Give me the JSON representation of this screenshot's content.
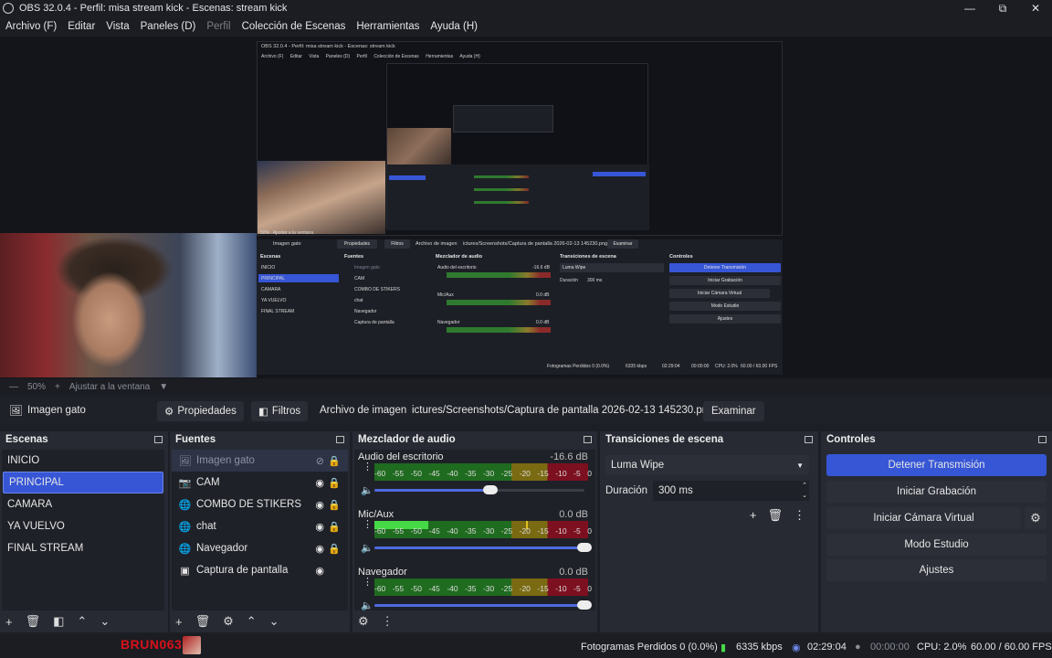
{
  "window": {
    "title": "OBS 32.0.4 - Perfil: misa stream kick - Escenas: stream kick",
    "min_icon": "minimize-icon",
    "max_icon": "maximize-icon",
    "close_icon": "close-icon"
  },
  "menu": {
    "items": [
      "Archivo (F)",
      "Editar",
      "Vista",
      "Paneles (D)",
      "Perfil",
      "Colección de Escenas",
      "Herramientas",
      "Ayuda (H)"
    ]
  },
  "nested_preview": {
    "title": "OBS 32.0.4 - Perfil: misa stream kick - Escenas: stream kick",
    "menu": [
      "Archivo (F)",
      "Editar",
      "Vista",
      "Paneles (D)",
      "Perfil",
      "Colección de Escenas",
      "Herramientas",
      "Ayuda (H)"
    ],
    "zoom": "50%",
    "fit": "Ajustar a la ventana",
    "source_name": "Imagen gato",
    "props": "Propiedades",
    "filters": "Filtros",
    "file_label": "Archivo de imagen",
    "path": "ictures/Screenshots/Captura de pantalla 2026-02-13 145230.png",
    "browse": "Examinar",
    "scenes_title": "Escenas",
    "sources_title": "Fuentes",
    "mixer_title": "Mezclador de audio",
    "transitions_title": "Transiciones de escena",
    "controls_title": "Controles",
    "scenes": [
      "INICIO",
      "PRINCIPAL",
      "CAMARA",
      "YA VUELVO",
      "FINAL STREAM"
    ],
    "sources": [
      "Imagen gato",
      "CAM",
      "COMBO DE STIKERS",
      "chat",
      "Navegador",
      "Captura de pantalla"
    ],
    "mixer": [
      {
        "name": "Audio del escritorio",
        "db": "-16.6 dB"
      },
      {
        "name": "Mic/Aux",
        "db": "0.0 dB"
      },
      {
        "name": "Navegador",
        "db": "0.0 dB"
      }
    ],
    "transition": "Luma Wipe",
    "duration_label": "Duración",
    "duration": "300 ms",
    "controls": [
      "Detener Transmisión",
      "Iniciar Grabación",
      "Iniciar Cámara Virtual",
      "Modo Estudio",
      "Ajustes"
    ],
    "status": {
      "dropped": "Fotogramas Perdidos 0 (0.0%)",
      "kbps": "6335 kbps",
      "live": "02:29:04",
      "rec": "00:00:00",
      "cpu": "CPU: 2.0%",
      "fps": "60.00 / 60.00 FPS"
    }
  },
  "zoom": {
    "value": "50%",
    "fit": "Ajustar a la ventana"
  },
  "source_toolbar": {
    "source_name": "Imagen gato",
    "properties": "Propiedades",
    "filters": "Filtros",
    "file_label": "Archivo de imagen",
    "path": "ictures/Screenshots/Captura de pantalla 2026-02-13 145230.png",
    "browse": "Examinar"
  },
  "scenes": {
    "title": "Escenas",
    "items": [
      "INICIO",
      "PRINCIPAL",
      "CAMARA",
      "YA VUELVO",
      "FINAL STREAM"
    ],
    "selected": "PRINCIPAL"
  },
  "sources": {
    "title": "Fuentes",
    "items": [
      {
        "name": "Imagen gato",
        "icon": "image-icon",
        "visible": false
      },
      {
        "name": "CAM",
        "icon": "camera-icon",
        "visible": true
      },
      {
        "name": "COMBO DE STIKERS",
        "icon": "globe-icon",
        "visible": true
      },
      {
        "name": "chat",
        "icon": "globe-icon",
        "visible": true
      },
      {
        "name": "Navegador",
        "icon": "globe-icon",
        "visible": true
      },
      {
        "name": "Captura de pantalla",
        "icon": "monitor-icon",
        "visible": true
      }
    ]
  },
  "mixer": {
    "title": "Mezclador de audio",
    "scale": [
      "-60",
      "-55",
      "-50",
      "-45",
      "-40",
      "-35",
      "-30",
      "-25",
      "-20",
      "-15",
      "-10",
      "-5",
      "0"
    ],
    "channels": [
      {
        "name": "Audio del escritorio",
        "db": "-16.6 dB",
        "level": 0,
        "volume": 0.55
      },
      {
        "name": "Mic/Aux",
        "db": "0.0 dB",
        "level": 0.25,
        "peak": 0.71,
        "volume": 1.0
      },
      {
        "name": "Navegador",
        "db": "0.0 dB",
        "level": 0,
        "volume": 1.0
      }
    ]
  },
  "transitions": {
    "title": "Transiciones de escena",
    "selected": "Luma Wipe",
    "duration_label": "Duración",
    "duration": "300 ms"
  },
  "controls": {
    "title": "Controles",
    "stop_stream": "Detener Transmisión",
    "start_record": "Iniciar Grabación",
    "virtual_cam": "Iniciar Cámara Virtual",
    "studio_mode": "Modo Estudio",
    "settings": "Ajustes"
  },
  "status": {
    "brand": "BRUN063",
    "dropped": "Fotogramas Perdidos 0 (0.0%)",
    "kbps": "6335 kbps",
    "live_time": "02:29:04",
    "rec_time": "00:00:00",
    "cpu": "CPU: 2.0%",
    "fps": "60.00 / 60.00 FPS"
  },
  "colors": {
    "accent": "#3656d6",
    "background": "#1d1f26",
    "dock": "#272a33",
    "brand": "#d9111b"
  }
}
